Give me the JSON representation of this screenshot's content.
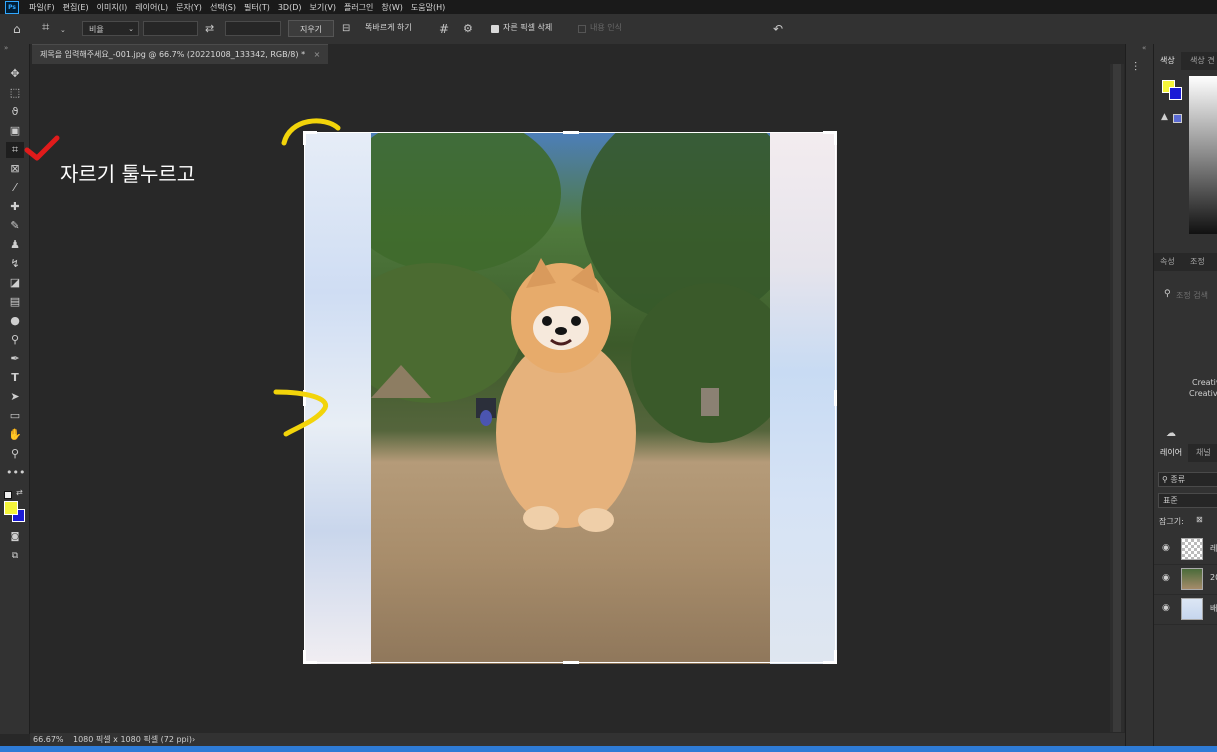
{
  "app": {
    "logo": "Ps"
  },
  "menu": [
    "파일(F)",
    "편집(E)",
    "이미지(I)",
    "레이어(L)",
    "문자(Y)",
    "선택(S)",
    "필터(T)",
    "3D(D)",
    "보기(V)",
    "플러그인",
    "창(W)",
    "도움말(H)"
  ],
  "options": {
    "ratio_select": "비율",
    "clear_button": "지우기",
    "straighten_label": "똑바르게 하기",
    "delete_cropped_label": "자른 픽셀 삭제",
    "content_aware_label": "내용 인식"
  },
  "document": {
    "tab_title": "제목을 입력해주세요_-001.jpg @ 66.7% (20221008_133342, RGB/8) *",
    "close_glyph": "×"
  },
  "annotation": {
    "text": "자르기 툴누르고"
  },
  "status": {
    "zoom": "66.67%",
    "info": "1080 픽셀 x 1080 픽셀 (72 ppi)",
    "arrow": "›"
  },
  "panels": {
    "color_tabs": [
      "색상",
      "색상 견"
    ],
    "props_tabs": [
      "속성",
      "조정"
    ],
    "props_search": "조정 검색",
    "cc_line1": "Creativ",
    "cc_line2": "Creative",
    "layer_tabs": [
      "레이어",
      "채널"
    ],
    "layer_kind": "종류",
    "blend_mode": "표준",
    "lock_label": "잠그기:",
    "layers": [
      {
        "name": "레"
      },
      {
        "name": "20"
      },
      {
        "name": "배"
      }
    ]
  },
  "colors": {
    "foreground": "#f5f53a",
    "background": "#1b1bd6",
    "accent": "#31a8ff",
    "annotation_yellow": "#f2d40a",
    "annotation_red": "#e01b1b"
  },
  "icons": [
    "home-icon",
    "crop-icon",
    "swap-icon",
    "grid-icon",
    "gear-icon",
    "reset-icon",
    "move-icon",
    "marquee-icon",
    "lasso-icon",
    "select-icon",
    "crop-tool-icon",
    "frame-icon",
    "eyedropper-icon",
    "heal-icon",
    "brush-icon",
    "stamp-icon",
    "history-brush-icon",
    "eraser-icon",
    "gradient-icon",
    "blur-icon",
    "dodge-icon",
    "pen-icon",
    "type-icon",
    "path-select-icon",
    "rectangle-icon",
    "hand-icon",
    "zoom-icon",
    "more-icon"
  ]
}
